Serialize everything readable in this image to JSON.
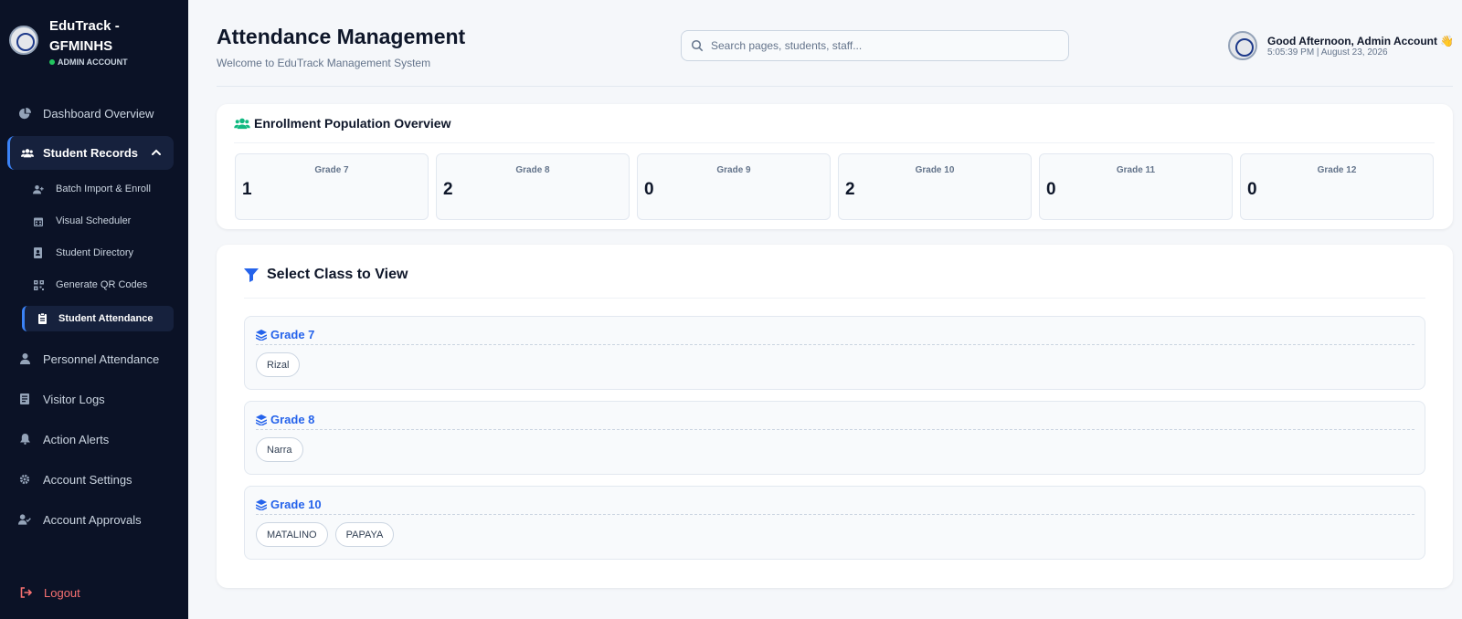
{
  "brand": {
    "title": "EduTrack - GFMINHS",
    "role": "ADMIN ACCOUNT"
  },
  "sidebar": {
    "items": [
      {
        "label": "Dashboard Overview",
        "icon": "chart-pie-icon"
      },
      {
        "label": "Student Records",
        "icon": "users-icon"
      },
      {
        "label": "Personnel Attendance",
        "icon": "user-icon"
      },
      {
        "label": "Visitor Logs",
        "icon": "id-badge-icon"
      },
      {
        "label": "Action Alerts",
        "icon": "bell-icon"
      },
      {
        "label": "Account Settings",
        "icon": "gear-icon"
      },
      {
        "label": "Account Approvals",
        "icon": "user-check-icon"
      }
    ],
    "sub_items": [
      {
        "label": "Batch Import & Enroll",
        "icon": "user-plus-icon"
      },
      {
        "label": "Visual Scheduler",
        "icon": "calendar-icon"
      },
      {
        "label": "Student Directory",
        "icon": "address-book-icon"
      },
      {
        "label": "Generate QR Codes",
        "icon": "qr-code-icon"
      },
      {
        "label": "Student Attendance",
        "icon": "clipboard-icon"
      }
    ],
    "logout": "Logout"
  },
  "header": {
    "title": "Attendance Management",
    "subtitle": "Welcome to EduTrack Management System",
    "search_placeholder": "Search pages, students, staff...",
    "greeting": "Good Afternoon, Admin Account 👋",
    "datetime": "5:05:39 PM | August 23, 2026"
  },
  "enrollment": {
    "title": "Enrollment Population Overview",
    "grades": [
      {
        "label": "Grade 7",
        "value": "1"
      },
      {
        "label": "Grade 8",
        "value": "2"
      },
      {
        "label": "Grade 9",
        "value": "0"
      },
      {
        "label": "Grade 10",
        "value": "2"
      },
      {
        "label": "Grade 11",
        "value": "0"
      },
      {
        "label": "Grade 12",
        "value": "0"
      }
    ]
  },
  "select_class": {
    "title": "Select Class to View",
    "groups": [
      {
        "grade": "Grade 7",
        "sections": [
          "Rizal"
        ]
      },
      {
        "grade": "Grade 8",
        "sections": [
          "Narra"
        ]
      },
      {
        "grade": "Grade 10",
        "sections": [
          "MATALINO",
          "PAPAYA"
        ]
      }
    ]
  },
  "colors": {
    "sidebar_bg": "#0b1226",
    "accent": "#2563eb",
    "success": "#22c55e",
    "logout": "#f87171"
  }
}
